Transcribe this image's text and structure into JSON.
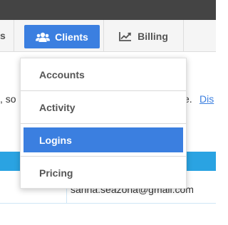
{
  "nav": {
    "left_edge_text": "s",
    "clients_label": "Clients",
    "billing_label": "Billing"
  },
  "content": {
    "partial_left": ", so",
    "partial_right": "e.",
    "partial_link": "Dis"
  },
  "table": {
    "email_value": "sahha.seazoha@gmail.com"
  },
  "dropdown": {
    "items": [
      {
        "label": "Accounts",
        "active": false
      },
      {
        "label": "Activity",
        "active": false
      },
      {
        "label": "Logins",
        "active": true
      },
      {
        "label": "Pricing",
        "active": false
      }
    ]
  },
  "colors": {
    "accent": "#3b7fe0",
    "table_header": "#2aa3e2",
    "topbar": "#444444"
  },
  "icons": {
    "clients": "users-icon",
    "billing": "line-chart-icon"
  }
}
